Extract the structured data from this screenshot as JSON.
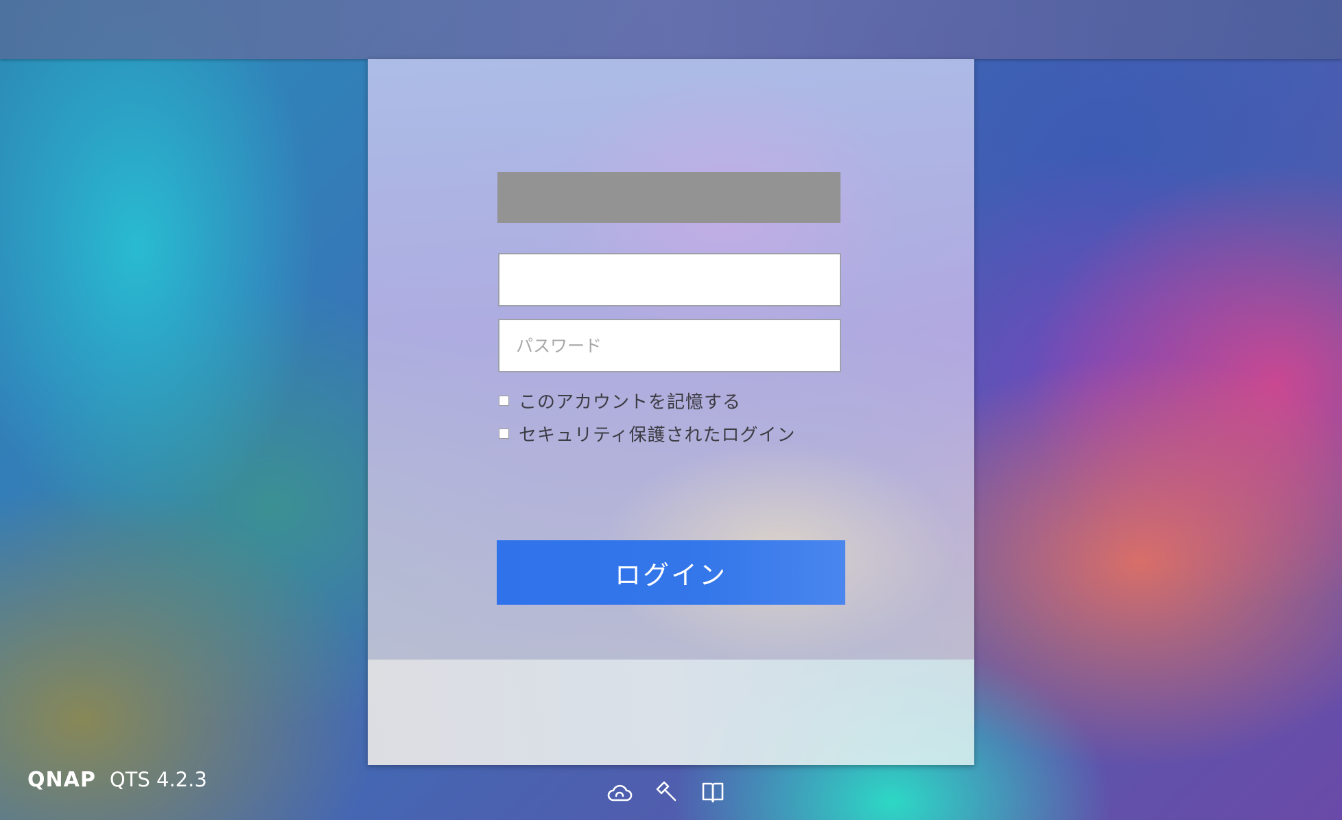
{
  "login": {
    "username_value": "",
    "username_placeholder": "",
    "password_placeholder": "パスワード",
    "remember_label": "このアカウントを記憶する",
    "secure_login_label": "セキュリティ保護されたログイン",
    "login_button_label": "ログイン"
  },
  "brand": {
    "company": "QNAP",
    "product_version": "QTS 4.2.3"
  },
  "icons": {
    "cloud": "cloud-icon",
    "tools": "hammer-icon",
    "manual": "book-icon"
  },
  "colors": {
    "accent": "#3177ea",
    "logo_placeholder": "#939393"
  }
}
